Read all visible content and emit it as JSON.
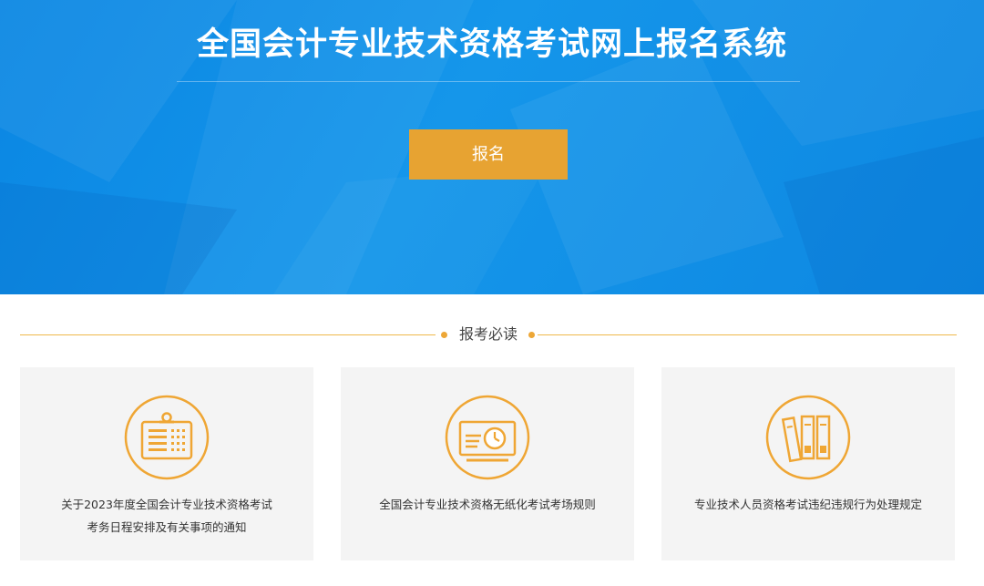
{
  "hero": {
    "title": "全国会计专业技术资格考试网上报名系统",
    "signup_label": "报名"
  },
  "section": {
    "title": "报考必读"
  },
  "cards": [
    {
      "icon": "clipboard-schedule-icon",
      "line1": "关于2023年度全国会计专业技术资格考试",
      "line2": "考务日程安排及有关事项的通知"
    },
    {
      "icon": "monitor-clock-icon",
      "line1": "全国会计专业技术资格无纸化考试考场规则",
      "line2": ""
    },
    {
      "icon": "books-icon",
      "line1": "专业技术人员资格考试违纪违规行为处理规定",
      "line2": ""
    }
  ],
  "colors": {
    "hero_blue": "#0d8ae4",
    "accent_orange": "#e7a332",
    "card_bg": "#f4f4f4"
  }
}
